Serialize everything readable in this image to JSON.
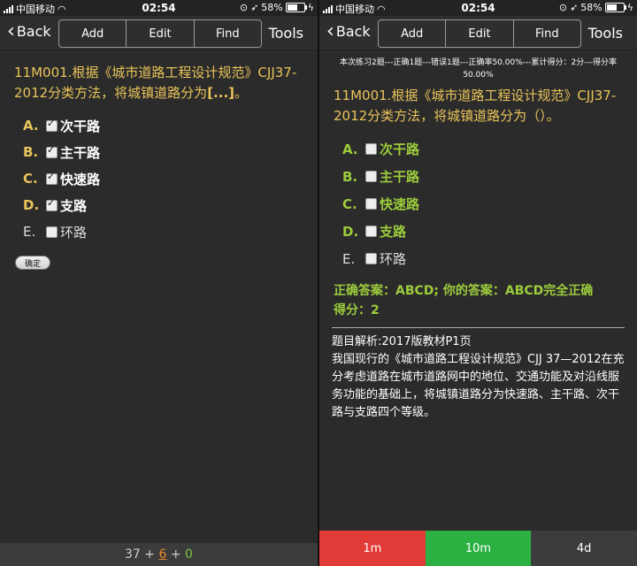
{
  "left": {
    "status": {
      "carrier": "中国移动",
      "time": "02:54",
      "battery": "58%"
    },
    "toolbar": {
      "back": "Back",
      "add": "Add",
      "edit": "Edit",
      "find": "Find",
      "tools": "Tools"
    },
    "question": {
      "text": "11M001.根据《城市道路工程设计规范》CJJ37-2012分类方法，将城镇道路分为",
      "blank": "[...]",
      "end": "。"
    },
    "options": [
      {
        "letter": "A.",
        "text": "次干路",
        "checked": true
      },
      {
        "letter": "B.",
        "text": "主干路",
        "checked": true
      },
      {
        "letter": "C.",
        "text": "快速路",
        "checked": true
      },
      {
        "letter": "D.",
        "text": "支路",
        "checked": true
      },
      {
        "letter": "E.",
        "text": "环路",
        "checked": false
      }
    ],
    "confirm": "确定",
    "footer": {
      "a": "37",
      "plus1": " + ",
      "b": "6",
      "plus2": " + ",
      "c": "0"
    }
  },
  "right": {
    "status": {
      "carrier": "中国移动",
      "time": "02:54",
      "battery": "58%"
    },
    "toolbar": {
      "back": "Back",
      "add": "Add",
      "edit": "Edit",
      "find": "Find",
      "tools": "Tools"
    },
    "summary": "本次练习2题---正确1题---错误1题---正确率50.00%---累计得分：2分---得分率50.00%",
    "question": "11M001.根据《城市道路工程设计规范》CJJ37-2012分类方法，将城镇道路分为（）。",
    "options": [
      {
        "letter": "A.",
        "text": "次干路"
      },
      {
        "letter": "B.",
        "text": "主干路"
      },
      {
        "letter": "C.",
        "text": "快速路"
      },
      {
        "letter": "D.",
        "text": "支路"
      },
      {
        "letter": "E.",
        "text": "环路"
      }
    ],
    "answer_line1": "正确答案：ABCD; 你的答案：ABCD完全正确",
    "answer_line2": "得分：2",
    "analysis_title": "题目解析:2017版教材P1页",
    "analysis_body": "我国现行的《城市道路工程设计规范》CJJ 37—2012在充分考虑道路在城市道路网中的地位、交通功能及对沿线服务功能的基础上，将城镇道路分为快速路、主干路、次干路与支路四个等级。",
    "buttons": {
      "again": "1m",
      "good": "10m",
      "easy": "4d"
    }
  }
}
